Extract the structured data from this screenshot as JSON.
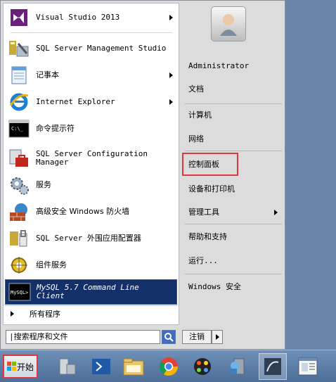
{
  "programs": [
    {
      "label": "Visual Studio 2013",
      "arrow": true,
      "icon": "visual-studio-icon"
    },
    {
      "label": "SQL Server Management Studio",
      "arrow": false,
      "icon": "sql-management-studio-icon"
    },
    {
      "label": "记事本",
      "arrow": true,
      "icon": "notepad-icon"
    },
    {
      "label": "Internet Explorer",
      "arrow": true,
      "icon": "internet-explorer-icon"
    },
    {
      "label": "命令提示符",
      "arrow": false,
      "icon": "command-prompt-icon"
    },
    {
      "label": "SQL Server Configuration Manager",
      "arrow": false,
      "icon": "sql-config-manager-icon"
    },
    {
      "label": "服务",
      "arrow": false,
      "icon": "services-icon"
    },
    {
      "label": "高级安全 Windows 防火墙",
      "arrow": false,
      "icon": "firewall-icon"
    },
    {
      "label": "SQL Server 外围应用配置器",
      "arrow": false,
      "icon": "sql-surface-config-icon"
    },
    {
      "label": "组件服务",
      "arrow": false,
      "icon": "component-services-icon"
    },
    {
      "label": "MySQL 5.7 Command Line Client",
      "arrow": false,
      "icon": "mysql-console-icon",
      "selected": true
    }
  ],
  "all_programs": "所有程序",
  "search": {
    "value": "|搜索程序和文件"
  },
  "user": {
    "name": "Administrator"
  },
  "right": {
    "documents": "文档",
    "computer": "计算机",
    "network": "网络",
    "control_panel": "控制面板",
    "devices_printers": "设备和打印机",
    "admin_tools": "管理工具",
    "help_support": "帮助和支持",
    "run": "运行...",
    "windows_security": "Windows 安全"
  },
  "logoff": "注销",
  "start_button": "开始",
  "taskbar": [
    "server-manager-icon",
    "powershell-icon",
    "explorer-folder-icon",
    "chrome-icon",
    "paint-icon",
    "user-setup-icon",
    "sql-mgmt-icon",
    "document-window-icon"
  ],
  "colors": {
    "selected_bg": "#13306b",
    "highlight_border": "#e0363f",
    "taskbar": "#5a7aa6"
  }
}
